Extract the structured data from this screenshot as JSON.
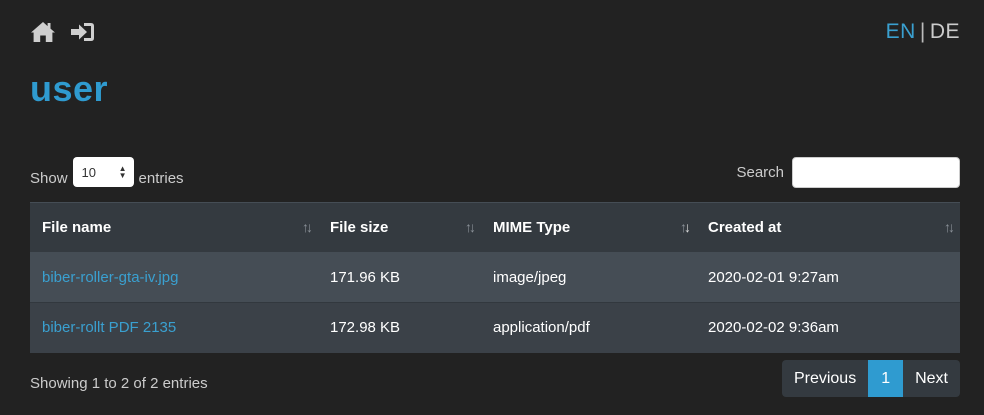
{
  "nav": {
    "home_icon": "home-icon",
    "login_icon": "sign-in-icon"
  },
  "lang": {
    "en": "EN",
    "separator": "|",
    "de": "DE"
  },
  "page": {
    "title": "user"
  },
  "length": {
    "show_label": "Show",
    "value": "10",
    "entries_label": "entries"
  },
  "search": {
    "label": "Search",
    "value": "",
    "placeholder": ""
  },
  "table": {
    "headers": [
      "File name",
      "File size",
      "MIME Type",
      "Created at"
    ],
    "sorted_column": 2,
    "rows": [
      {
        "name": "biber-roller-gta-iv.jpg",
        "size": "171.96 KB",
        "mime": "image/jpeg",
        "created": "2020-02-01 9:27am"
      },
      {
        "name": "biber-rollt PDF 2135",
        "size": "172.98 KB",
        "mime": "application/pdf",
        "created": "2020-02-02 9:36am"
      }
    ]
  },
  "info": "Showing 1 to 2 of 2 entries",
  "pagination": {
    "previous": "Previous",
    "current": "1",
    "next": "Next"
  },
  "colors": {
    "background": "#222222",
    "accent": "#2f9bd0",
    "header_bg": "#343a40",
    "row_odd": "#454d55",
    "row_even": "#3b4148"
  }
}
